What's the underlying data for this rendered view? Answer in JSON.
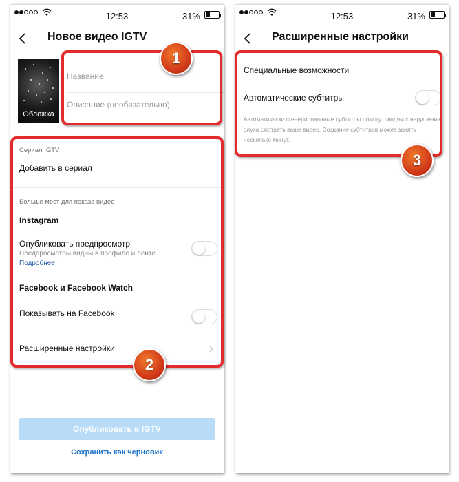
{
  "status_bar": {
    "time": "12:53",
    "battery": "31%",
    "battery_level": 0.31
  },
  "left_screen": {
    "title": "Новое видео IGTV",
    "cover_label": "Обложка",
    "name_placeholder": "Название",
    "description_placeholder": "Описание (необязательно)",
    "series_section": "Сериал IGTV",
    "add_to_series": "Добавить в сериал",
    "more_places_section": "Больше мест для показа видео",
    "instagram_heading": "Instagram",
    "publish_preview_label": "Опубликовать предпросмотр",
    "publish_preview_sub": "Предпросмотры видны в профиле и ленте",
    "more_link": "Подробнее",
    "facebook_heading": "Facebook и Facebook Watch",
    "show_on_facebook": "Показывать на Facebook",
    "advanced_settings": "Расширенные настройки",
    "publish_button": "Опубликовать в IGTV",
    "save_draft": "Сохранить как черновик"
  },
  "right_screen": {
    "title": "Расширенные настройки",
    "accessibility_section": "Специальные возможности",
    "auto_captions_label": "Автоматические субтитры",
    "auto_captions_desc": "Автоматически сгенерированные субтитры помогут людям с нарушения слуха смотреть ваше видео. Создание субтитров может занять несколько минут."
  },
  "annotations": {
    "badge1": "1",
    "badge2": "2",
    "badge3": "3",
    "color": "#e42b2b"
  },
  "toggles": {
    "publish_preview": false,
    "show_on_facebook": false,
    "auto_captions": false
  }
}
